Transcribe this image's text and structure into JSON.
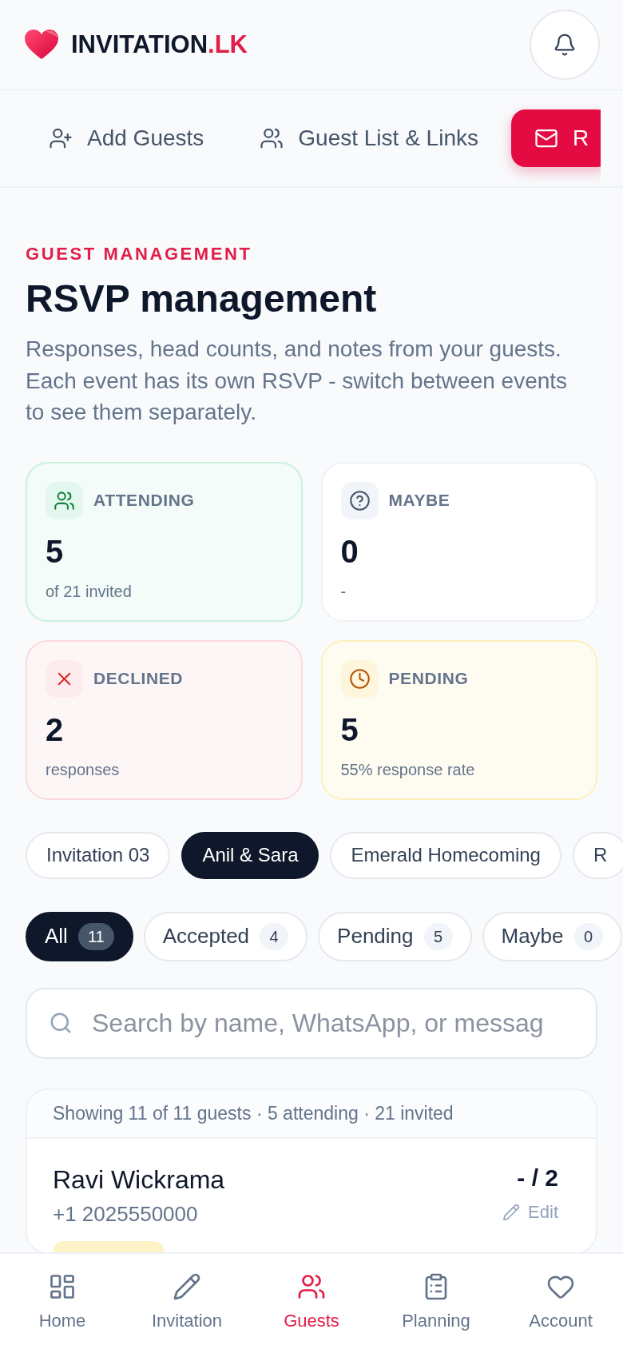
{
  "header": {
    "brand": "INVITATION",
    "brand_suffix": ".LK"
  },
  "tabs": [
    {
      "label": "Add Guests",
      "selected": false
    },
    {
      "label": "Guest List & Links",
      "selected": false
    },
    {
      "label": "R",
      "selected": true
    }
  ],
  "intro": {
    "eyebrow": "GUEST MANAGEMENT",
    "title": "RSVP management",
    "description": "Responses, head counts, and notes from your guests. Each event has its own RSVP - switch between events to see them separately."
  },
  "stats": [
    {
      "kind": "attending",
      "label": "ATTENDING",
      "value": "5",
      "note": "of 21 invited"
    },
    {
      "kind": "maybe",
      "label": "MAYBE",
      "value": "0",
      "note": "-"
    },
    {
      "kind": "declined",
      "label": "DECLINED",
      "value": "2",
      "note": "responses"
    },
    {
      "kind": "pending",
      "label": "PENDING",
      "value": "5",
      "note": "55% response rate"
    }
  ],
  "events": [
    {
      "label": "Invitation 03",
      "selected": false
    },
    {
      "label": "Anil & Sara",
      "selected": true
    },
    {
      "label": "Emerald Homecoming",
      "selected": false
    },
    {
      "label": "R",
      "selected": false
    }
  ],
  "filters": [
    {
      "label": "All",
      "count": "11",
      "selected": true
    },
    {
      "label": "Accepted",
      "count": "4",
      "selected": false
    },
    {
      "label": "Pending",
      "count": "5",
      "selected": false
    },
    {
      "label": "Maybe",
      "count": "0",
      "selected": false
    }
  ],
  "search": {
    "placeholder": "Search by name, WhatsApp, or messag"
  },
  "guest_list": {
    "summary": "Showing 11 of 11 guests · 5 attending · 21 invited",
    "guests": [
      {
        "name": "Ravi Wickrama",
        "phone": "+1 2025550000",
        "head_count": "- / 2",
        "action": "Edit",
        "kind": "pending"
      }
    ]
  },
  "bottom_nav": [
    {
      "label": "Home",
      "selected": false
    },
    {
      "label": "Invitation",
      "selected": false
    },
    {
      "label": "Guests",
      "selected": true
    },
    {
      "label": "Planning",
      "selected": false
    },
    {
      "label": "Account",
      "selected": false
    }
  ]
}
